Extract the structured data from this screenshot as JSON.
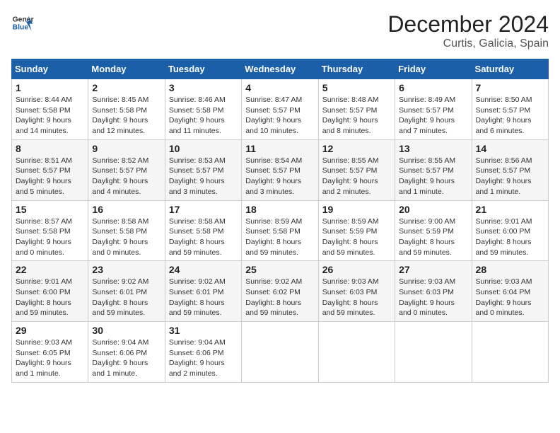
{
  "logo": {
    "line1": "General",
    "line2": "Blue"
  },
  "title": "December 2024",
  "location": "Curtis, Galicia, Spain",
  "weekdays": [
    "Sunday",
    "Monday",
    "Tuesday",
    "Wednesday",
    "Thursday",
    "Friday",
    "Saturday"
  ],
  "weeks": [
    [
      {
        "day": "1",
        "info": "Sunrise: 8:44 AM\nSunset: 5:58 PM\nDaylight: 9 hours and 14 minutes."
      },
      {
        "day": "2",
        "info": "Sunrise: 8:45 AM\nSunset: 5:58 PM\nDaylight: 9 hours and 12 minutes."
      },
      {
        "day": "3",
        "info": "Sunrise: 8:46 AM\nSunset: 5:58 PM\nDaylight: 9 hours and 11 minutes."
      },
      {
        "day": "4",
        "info": "Sunrise: 8:47 AM\nSunset: 5:57 PM\nDaylight: 9 hours and 10 minutes."
      },
      {
        "day": "5",
        "info": "Sunrise: 8:48 AM\nSunset: 5:57 PM\nDaylight: 9 hours and 8 minutes."
      },
      {
        "day": "6",
        "info": "Sunrise: 8:49 AM\nSunset: 5:57 PM\nDaylight: 9 hours and 7 minutes."
      },
      {
        "day": "7",
        "info": "Sunrise: 8:50 AM\nSunset: 5:57 PM\nDaylight: 9 hours and 6 minutes."
      }
    ],
    [
      {
        "day": "8",
        "info": "Sunrise: 8:51 AM\nSunset: 5:57 PM\nDaylight: 9 hours and 5 minutes."
      },
      {
        "day": "9",
        "info": "Sunrise: 8:52 AM\nSunset: 5:57 PM\nDaylight: 9 hours and 4 minutes."
      },
      {
        "day": "10",
        "info": "Sunrise: 8:53 AM\nSunset: 5:57 PM\nDaylight: 9 hours and 3 minutes."
      },
      {
        "day": "11",
        "info": "Sunrise: 8:54 AM\nSunset: 5:57 PM\nDaylight: 9 hours and 3 minutes."
      },
      {
        "day": "12",
        "info": "Sunrise: 8:55 AM\nSunset: 5:57 PM\nDaylight: 9 hours and 2 minutes."
      },
      {
        "day": "13",
        "info": "Sunrise: 8:55 AM\nSunset: 5:57 PM\nDaylight: 9 hours and 1 minute."
      },
      {
        "day": "14",
        "info": "Sunrise: 8:56 AM\nSunset: 5:57 PM\nDaylight: 9 hours and 1 minute."
      }
    ],
    [
      {
        "day": "15",
        "info": "Sunrise: 8:57 AM\nSunset: 5:58 PM\nDaylight: 9 hours and 0 minutes."
      },
      {
        "day": "16",
        "info": "Sunrise: 8:58 AM\nSunset: 5:58 PM\nDaylight: 9 hours and 0 minutes."
      },
      {
        "day": "17",
        "info": "Sunrise: 8:58 AM\nSunset: 5:58 PM\nDaylight: 8 hours and 59 minutes."
      },
      {
        "day": "18",
        "info": "Sunrise: 8:59 AM\nSunset: 5:58 PM\nDaylight: 8 hours and 59 minutes."
      },
      {
        "day": "19",
        "info": "Sunrise: 8:59 AM\nSunset: 5:59 PM\nDaylight: 8 hours and 59 minutes."
      },
      {
        "day": "20",
        "info": "Sunrise: 9:00 AM\nSunset: 5:59 PM\nDaylight: 8 hours and 59 minutes."
      },
      {
        "day": "21",
        "info": "Sunrise: 9:01 AM\nSunset: 6:00 PM\nDaylight: 8 hours and 59 minutes."
      }
    ],
    [
      {
        "day": "22",
        "info": "Sunrise: 9:01 AM\nSunset: 6:00 PM\nDaylight: 8 hours and 59 minutes."
      },
      {
        "day": "23",
        "info": "Sunrise: 9:02 AM\nSunset: 6:01 PM\nDaylight: 8 hours and 59 minutes."
      },
      {
        "day": "24",
        "info": "Sunrise: 9:02 AM\nSunset: 6:01 PM\nDaylight: 8 hours and 59 minutes."
      },
      {
        "day": "25",
        "info": "Sunrise: 9:02 AM\nSunset: 6:02 PM\nDaylight: 8 hours and 59 minutes."
      },
      {
        "day": "26",
        "info": "Sunrise: 9:03 AM\nSunset: 6:03 PM\nDaylight: 8 hours and 59 minutes."
      },
      {
        "day": "27",
        "info": "Sunrise: 9:03 AM\nSunset: 6:03 PM\nDaylight: 9 hours and 0 minutes."
      },
      {
        "day": "28",
        "info": "Sunrise: 9:03 AM\nSunset: 6:04 PM\nDaylight: 9 hours and 0 minutes."
      }
    ],
    [
      {
        "day": "29",
        "info": "Sunrise: 9:03 AM\nSunset: 6:05 PM\nDaylight: 9 hours and 1 minute."
      },
      {
        "day": "30",
        "info": "Sunrise: 9:04 AM\nSunset: 6:06 PM\nDaylight: 9 hours and 1 minute."
      },
      {
        "day": "31",
        "info": "Sunrise: 9:04 AM\nSunset: 6:06 PM\nDaylight: 9 hours and 2 minutes."
      },
      {
        "day": "",
        "info": ""
      },
      {
        "day": "",
        "info": ""
      },
      {
        "day": "",
        "info": ""
      },
      {
        "day": "",
        "info": ""
      }
    ]
  ]
}
